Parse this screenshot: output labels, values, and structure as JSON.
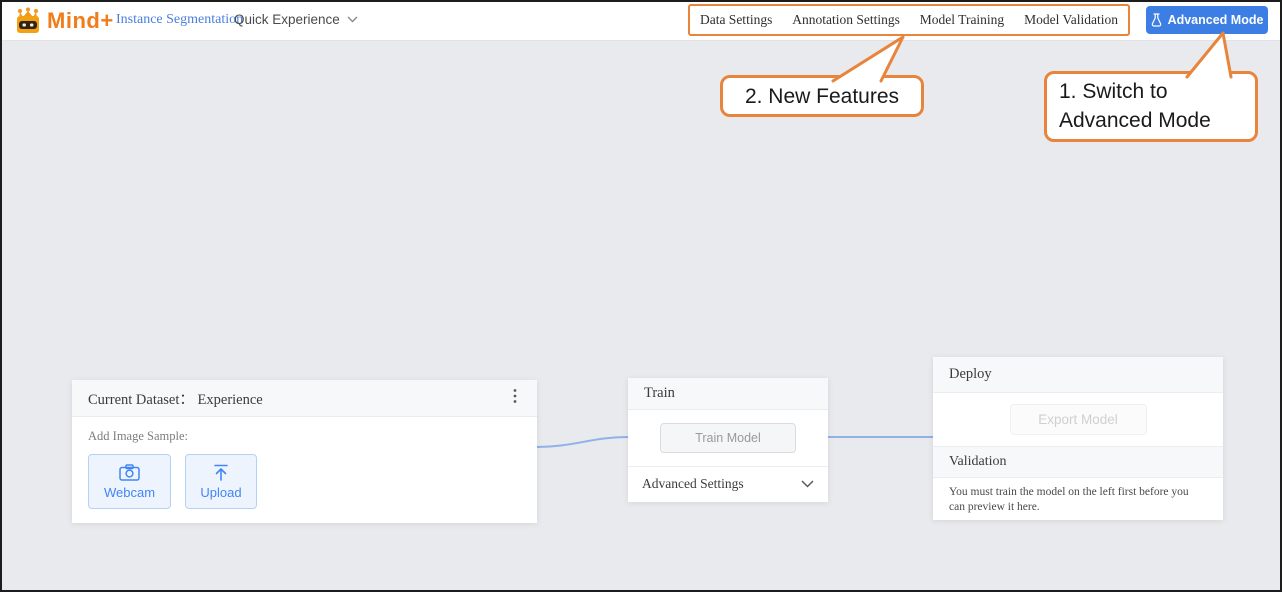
{
  "header": {
    "logo_text": "Mind+",
    "project_link": "Instance Segmentation",
    "mode_select": "Quick Experience",
    "menu_items": [
      "Data Settings",
      "Annotation Settings",
      "Model Training",
      "Model Validation"
    ],
    "advanced_mode_label": "Advanced Mode"
  },
  "callouts": {
    "step1": "1. Switch to Advanced Mode",
    "step2": "2. New Features"
  },
  "dataset_card": {
    "title": "Current Dataset：  Experience",
    "add_sample_label": "Add Image Sample:",
    "webcam_label": "Webcam",
    "upload_label": "Upload"
  },
  "train_card": {
    "title": "Train",
    "train_button_label": "Train Model",
    "advanced_settings_label": "Advanced Settings"
  },
  "deploy_card": {
    "title": "Deploy",
    "export_button_label": "Export Model",
    "validation_title": "Validation",
    "validation_message": "You must train the model on the left first before you can preview it here."
  },
  "colors": {
    "accent_orange": "#e8843c",
    "primary_blue": "#3d7ee5",
    "link_blue": "#4a7fe0",
    "connector_blue": "#8fb2e8",
    "canvas_bg": "#e9eaee"
  }
}
